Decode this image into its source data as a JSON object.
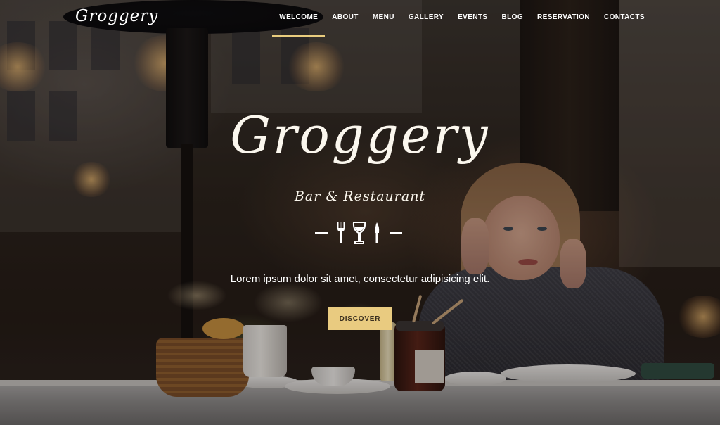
{
  "brand": {
    "logo_text": "Groggery"
  },
  "nav": {
    "items": [
      {
        "label": "WELCOME",
        "active": true
      },
      {
        "label": "ABOUT",
        "active": false
      },
      {
        "label": "MENU",
        "active": false
      },
      {
        "label": "GALLERY",
        "active": false
      },
      {
        "label": "EVENTS",
        "active": false
      },
      {
        "label": "BLOG",
        "active": false
      },
      {
        "label": "RESERVATION",
        "active": false
      },
      {
        "label": "CONTACTS",
        "active": false
      }
    ]
  },
  "hero": {
    "title": "Groggery",
    "subtitle": "Bar & Restaurant",
    "divider_icons": [
      "fork-icon",
      "wine-glass-icon",
      "knife-icon"
    ],
    "text": "Lorem ipsum dolor sit amet, consectetur adipisicing elit.",
    "button_label": "DISCOVER"
  },
  "colors": {
    "accent": "#e9cb80",
    "text": "#ffffff"
  }
}
